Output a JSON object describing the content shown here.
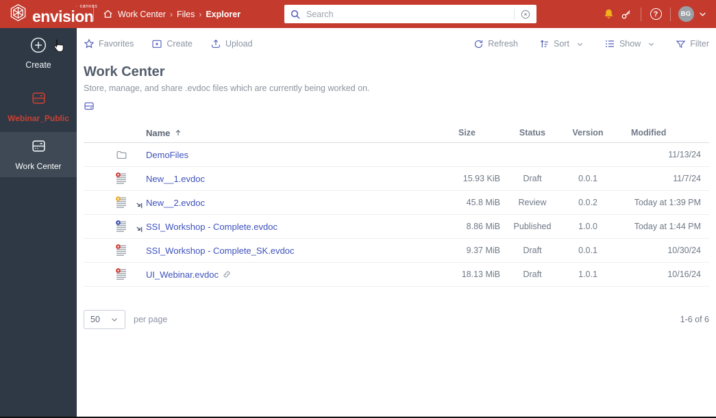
{
  "colors": {
    "topbar": "#c43b2e",
    "sidebar": "#2e3945",
    "sidebar_selected": "#3e4955",
    "accent_indigo": "#4a56b8",
    "link_blue": "#3d51bc",
    "badge_red": "#cf3e36",
    "badge_yellow": "#efa81c",
    "badge_blue": "#3f51b5",
    "bell_amber": "#f2b01e"
  },
  "topbar": {
    "logo_text": "envision",
    "logo_sup": "canvas",
    "breadcrumb": {
      "items": [
        "Work Center",
        "Files",
        "Explorer"
      ],
      "separator": "›"
    },
    "search": {
      "placeholder": "Search",
      "value": ""
    },
    "avatar_initials": "BG"
  },
  "sidebar": {
    "create_label": "Create",
    "items": [
      {
        "label": "Webinar_Public",
        "selected": false
      },
      {
        "label": "Work Center",
        "selected": true
      }
    ]
  },
  "toolbar": {
    "favorites": "Favorites",
    "create": "Create",
    "upload": "Upload",
    "refresh": "Refresh",
    "sort": "Sort",
    "show": "Show",
    "filter": "Filter"
  },
  "page": {
    "title": "Work Center",
    "subtitle": "Store, manage, and share .evdoc files which are currently being worked on."
  },
  "table": {
    "columns": {
      "name": "Name",
      "size": "Size",
      "status": "Status",
      "version": "Version",
      "modified": "Modified"
    },
    "sort_column": "Name",
    "sort_direction": "ascending",
    "rows": [
      {
        "icon": "folder",
        "name": "DemoFiles",
        "size": "",
        "status": "",
        "version": "",
        "modified": "11/13/24",
        "checked_out": false,
        "linked": false
      },
      {
        "icon": "evdoc",
        "badge_color": "#cf3e36",
        "name": "New__1.evdoc",
        "size": "15.93 KiB",
        "status": "Draft",
        "version": "0.0.1",
        "modified": "11/7/24",
        "checked_out": false,
        "linked": false
      },
      {
        "icon": "evdoc",
        "badge_color": "#efa81c",
        "name": "New__2.evdoc",
        "size": "45.8 MiB",
        "status": "Review",
        "version": "0.0.2",
        "modified": "Today at 1:39 PM",
        "checked_out": true,
        "linked": false
      },
      {
        "icon": "evdoc",
        "badge_color": "#3f51b5",
        "name": "SSI_Workshop - Complete.evdoc",
        "size": "8.86 MiB",
        "status": "Published",
        "version": "1.0.0",
        "modified": "Today at 1:44 PM",
        "checked_out": true,
        "linked": false
      },
      {
        "icon": "evdoc",
        "badge_color": "#cf3e36",
        "name": "SSI_Workshop - Complete_SK.evdoc",
        "size": "9.37 MiB",
        "status": "Draft",
        "version": "0.0.1",
        "modified": "10/30/24",
        "checked_out": false,
        "linked": false
      },
      {
        "icon": "evdoc",
        "badge_color": "#cf3e36",
        "name": "UI_Webinar.evdoc",
        "size": "18.13 MiB",
        "status": "Draft",
        "version": "1.0.1",
        "modified": "10/16/24",
        "checked_out": false,
        "linked": true
      }
    ]
  },
  "footer": {
    "per_page_value": "50",
    "per_page_label": "per page",
    "range": "1-6 of 6"
  }
}
